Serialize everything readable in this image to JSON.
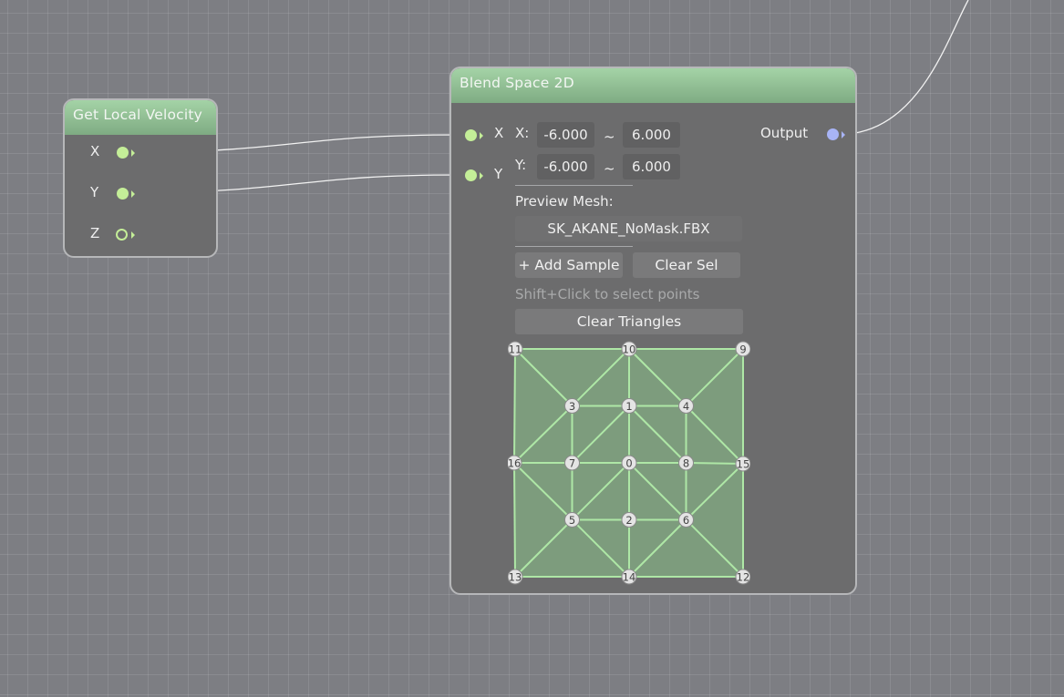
{
  "velocity_node": {
    "title": "Get Local Velocity",
    "outputs": [
      {
        "label": "X",
        "connected": true
      },
      {
        "label": "Y",
        "connected": true
      },
      {
        "label": "Z",
        "connected": false
      }
    ]
  },
  "blend_node": {
    "title": "Blend Space 2D",
    "inputs": [
      {
        "label": "X"
      },
      {
        "label": "Y"
      }
    ],
    "output_label": "Output",
    "x_range": {
      "label": "X:",
      "min": "-6.000",
      "sep": "~",
      "max": "6.000"
    },
    "y_range": {
      "label": "Y:",
      "min": "-6.000",
      "sep": "~",
      "max": "6.000"
    },
    "preview_mesh_label": "Preview Mesh:",
    "preview_mesh_value": "SK_AKANE_NoMask.FBX",
    "add_sample_label": "+ Add Sample",
    "clear_sel_label": "Clear Sel",
    "hint": "Shift+Click to select points",
    "clear_triangles_label": "Clear Triangles",
    "samples": [
      {
        "id": "0",
        "x": 0,
        "y": 0
      },
      {
        "id": "1",
        "x": 0,
        "y": 1
      },
      {
        "id": "2",
        "x": 0,
        "y": -1
      },
      {
        "id": "3",
        "x": -1,
        "y": 1
      },
      {
        "id": "4",
        "x": 1,
        "y": 1
      },
      {
        "id": "5",
        "x": -1,
        "y": -1
      },
      {
        "id": "6",
        "x": 1,
        "y": -1
      },
      {
        "id": "7",
        "x": -1,
        "y": 0
      },
      {
        "id": "8",
        "x": 1,
        "y": 0
      },
      {
        "id": "9",
        "x": 2,
        "y": 2
      },
      {
        "id": "10",
        "x": 0,
        "y": 2
      },
      {
        "id": "11",
        "x": -2,
        "y": 2
      },
      {
        "id": "12",
        "x": 2,
        "y": -2
      },
      {
        "id": "13",
        "x": -2,
        "y": -2
      },
      {
        "id": "14",
        "x": 0,
        "y": -2
      },
      {
        "id": "15",
        "x": 2,
        "y": 0
      },
      {
        "id": "16",
        "x": -2,
        "y": 0
      }
    ],
    "triangles": [
      [
        "11",
        "10",
        "3"
      ],
      [
        "10",
        "3",
        "1"
      ],
      [
        "10",
        "1",
        "4"
      ],
      [
        "10",
        "4",
        "9"
      ],
      [
        "9",
        "4",
        "15"
      ],
      [
        "11",
        "3",
        "16"
      ],
      [
        "3",
        "16",
        "7"
      ],
      [
        "3",
        "7",
        "1"
      ],
      [
        "1",
        "7",
        "0"
      ],
      [
        "1",
        "0",
        "8"
      ],
      [
        "1",
        "8",
        "4"
      ],
      [
        "4",
        "8",
        "15"
      ],
      [
        "16",
        "7",
        "5"
      ],
      [
        "7",
        "5",
        "0"
      ],
      [
        "0",
        "5",
        "2"
      ],
      [
        "0",
        "2",
        "6"
      ],
      [
        "0",
        "6",
        "8"
      ],
      [
        "8",
        "6",
        "15"
      ],
      [
        "16",
        "5",
        "13"
      ],
      [
        "13",
        "5",
        "14"
      ],
      [
        "5",
        "14",
        "2"
      ],
      [
        "2",
        "14",
        "6"
      ],
      [
        "14",
        "6",
        "12"
      ],
      [
        "6",
        "12",
        "15"
      ]
    ],
    "colors": {
      "mesh_fill": "#7d9c7d",
      "mesh_edge": "#aee7a6"
    }
  },
  "wires": [
    {
      "from": "Get Local Velocity.X",
      "to": "Blend Space 2D.X"
    },
    {
      "from": "Get Local Velocity.Y",
      "to": "Blend Space 2D.Y"
    },
    {
      "from": "Blend Space 2D.Output",
      "to": "offscreen"
    }
  ]
}
